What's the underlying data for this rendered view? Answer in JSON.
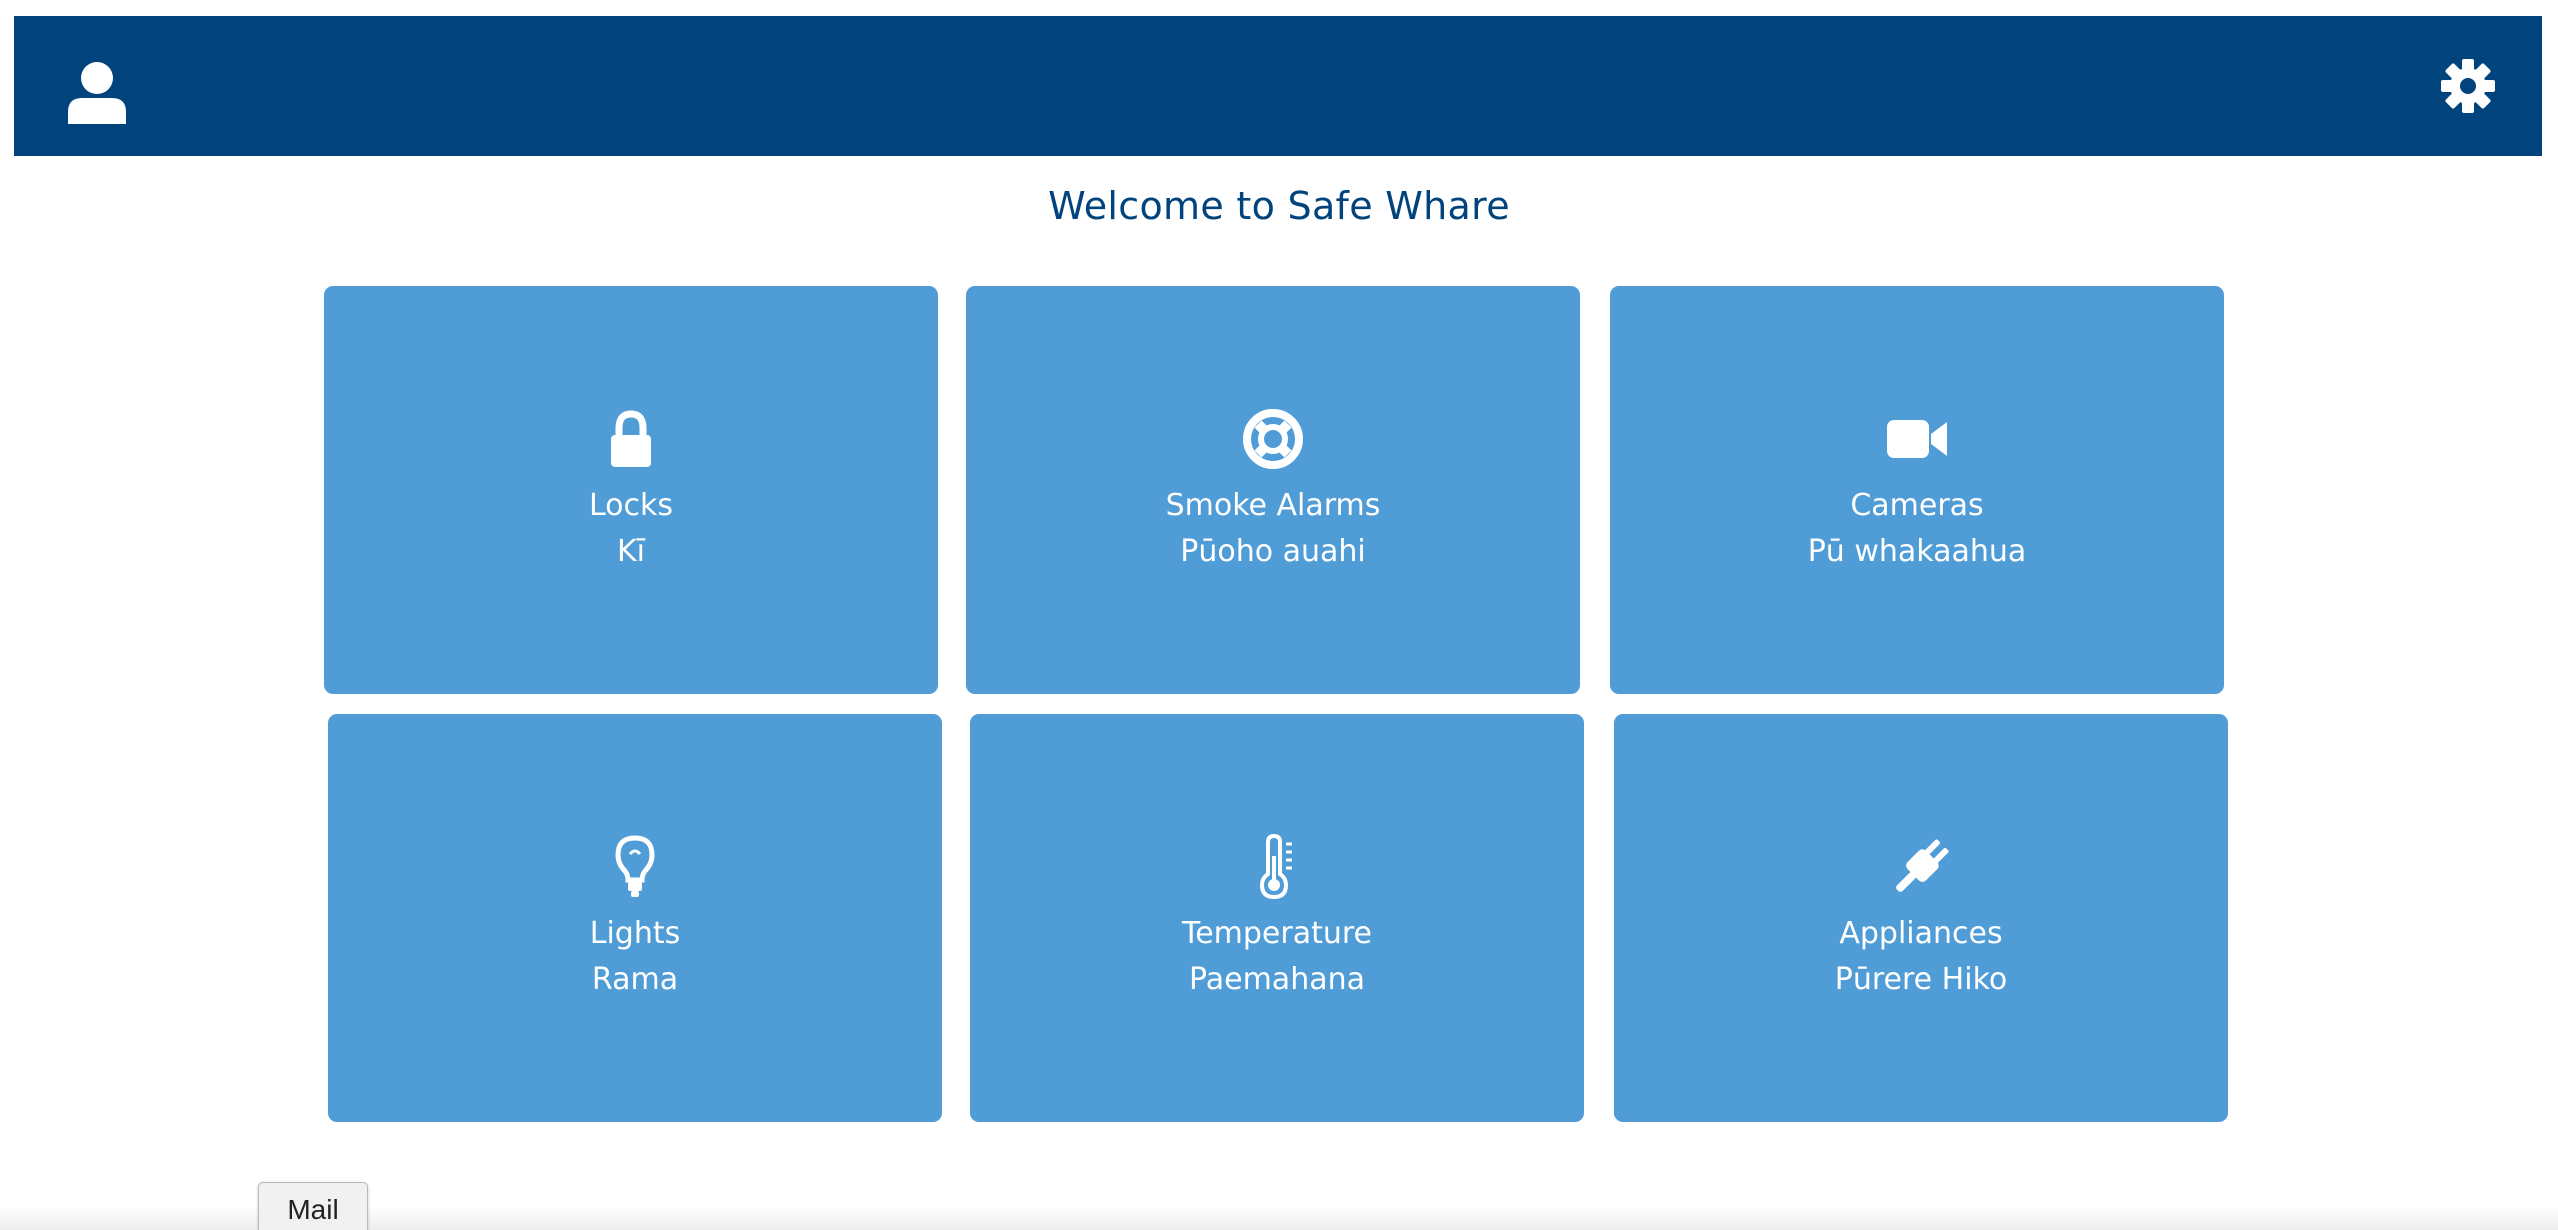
{
  "header": {
    "background_color": "#01437c",
    "user_icon": "user-icon",
    "settings_icon": "gear-icon"
  },
  "page_title": "Welcome to Safe Whare",
  "tiles": [
    {
      "icon": "lock-icon",
      "label_en": "Locks",
      "label_mi": "Kī"
    },
    {
      "icon": "life-ring-icon",
      "label_en": "Smoke Alarms",
      "label_mi": "Pūoho auahi"
    },
    {
      "icon": "video-camera-icon",
      "label_en": "Cameras",
      "label_mi": "Pū whakaahua"
    },
    {
      "icon": "lightbulb-icon",
      "label_en": "Lights",
      "label_mi": "Rama"
    },
    {
      "icon": "thermometer-icon",
      "label_en": "Temperature",
      "label_mi": "Paemahana"
    },
    {
      "icon": "plug-icon",
      "label_en": "Appliances",
      "label_mi": "Pūrere Hiko"
    }
  ],
  "tile_color": "#4f9cd7",
  "mail_button": {
    "label": "Mail"
  }
}
